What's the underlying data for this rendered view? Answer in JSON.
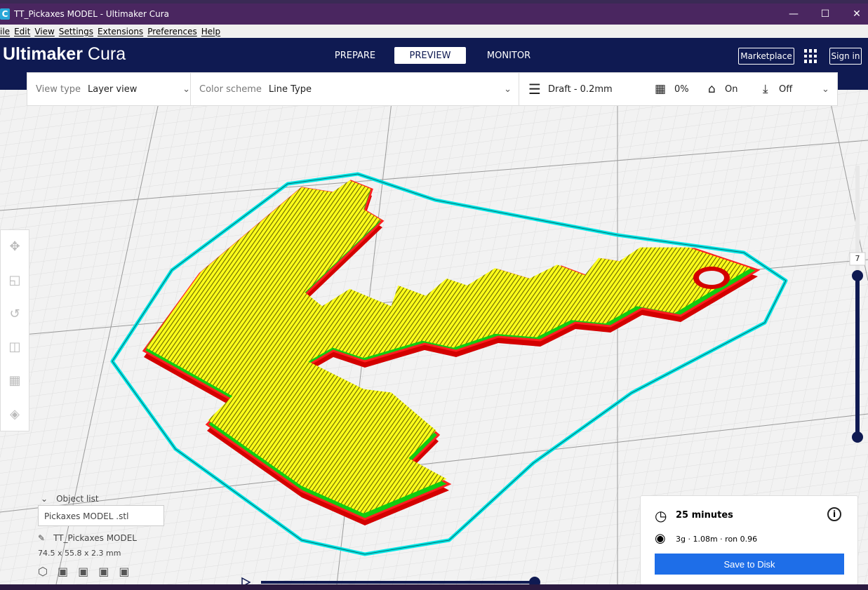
{
  "window": {
    "title": "TT_Pickaxes MODEL  - Ultimaker Cura",
    "app_icon": "C",
    "controls": [
      "minimize-icon",
      "maximize-icon",
      "close-icon"
    ]
  },
  "menu": [
    "ile",
    "Edit",
    "View",
    "Settings",
    "Extensions",
    "Preferences",
    "Help"
  ],
  "header": {
    "brand_bold": "Ultimaker",
    "brand_light": "Cura",
    "stages": [
      "PREPARE",
      "PREVIEW",
      "MONITOR"
    ],
    "active_stage": "PREVIEW",
    "marketplace": "Marketplace",
    "signin": "Sign in"
  },
  "toolbar": {
    "view_type_label": "View type",
    "view_type": "Layer view",
    "color_scheme_label": "Color scheme",
    "color_scheme": "Line Type",
    "profile": "Draft - 0.2mm",
    "infill": "0%",
    "support": "On",
    "adhesion": "Off"
  },
  "layer_slider": {
    "current_layer": "7",
    "fraction": 1.0
  },
  "playback": {
    "progress": 1.0
  },
  "object_list": {
    "label": "Object list",
    "item": "Pickaxes MODEL .stl",
    "object_name": "TT_Pickaxes MODEL",
    "dimensions": "74.5 x 55.8 x 2.3 mm"
  },
  "result": {
    "time": "25 minutes",
    "material": "3g · 1.08m · ron 0.96",
    "save": "Save to Disk"
  },
  "colors": {
    "header": "#0f1a52",
    "accent": "#1e6ee8",
    "infill": "#ffff00",
    "wall": "#ff0000",
    "inner_wall": "#00ff00",
    "skirt": "#00ffff"
  }
}
